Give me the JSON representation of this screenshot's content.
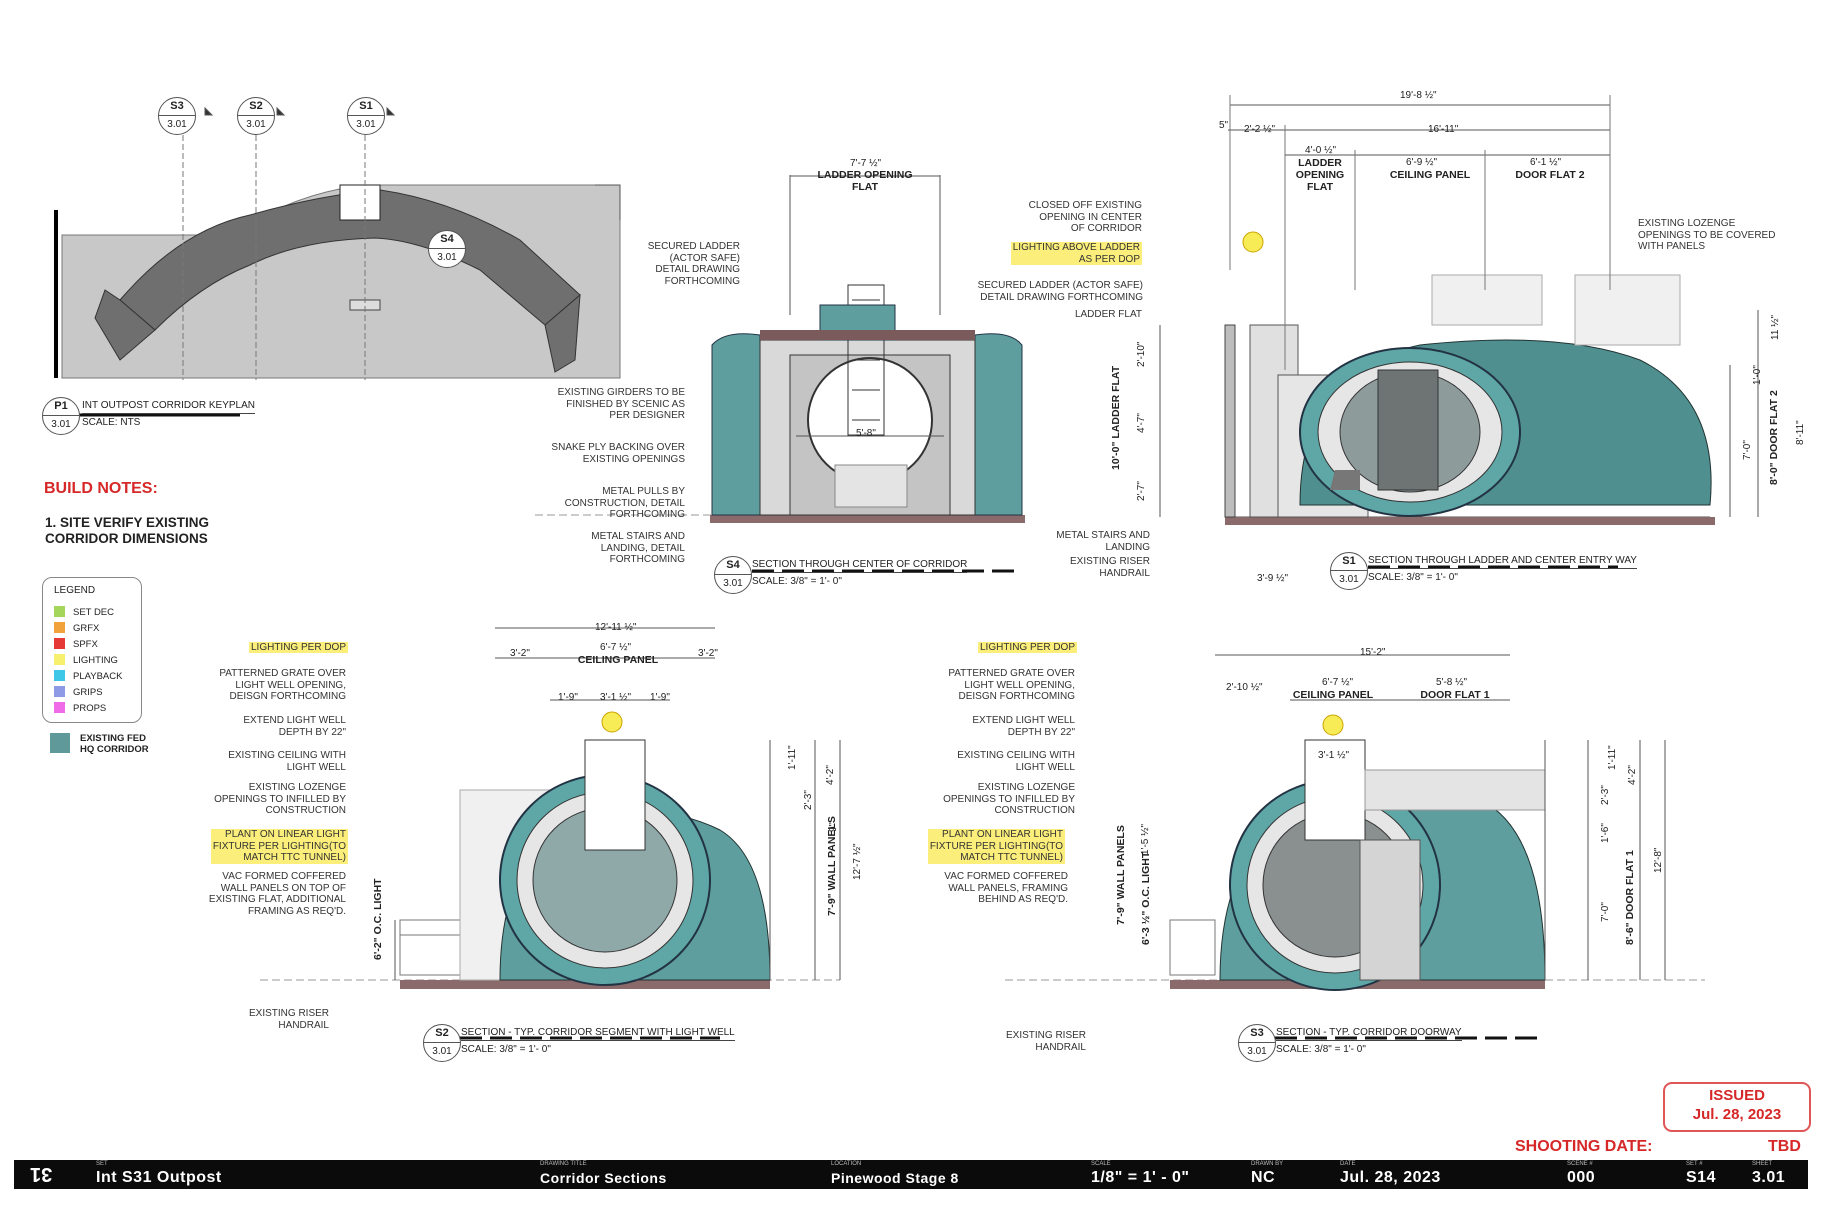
{
  "keyplan": {
    "tag_id": "P1",
    "tag_sheet": "3.01",
    "title": "INT OUTPOST CORRIDOR KEYPLAN",
    "scale": "SCALE: NTS",
    "markers": [
      {
        "id": "S3",
        "sheet": "3.01"
      },
      {
        "id": "S2",
        "sheet": "3.01"
      },
      {
        "id": "S1",
        "sheet": "3.01"
      }
    ],
    "s4_id": "S4",
    "s4_sheet": "3.01"
  },
  "notes": {
    "heading": "BUILD NOTES:",
    "item1": "1. SITE VERIFY EXISTING\nCORRIDOR DIMENSIONS"
  },
  "legend": {
    "title": "LEGEND",
    "items": [
      {
        "label": "SET DEC",
        "color": "#a3d65a"
      },
      {
        "label": "GRFX",
        "color": "#f2a23a"
      },
      {
        "label": "SPFX",
        "color": "#e53935"
      },
      {
        "label": "LIGHTING",
        "color": "#f7ef6e"
      },
      {
        "label": "PLAYBACK",
        "color": "#3fc7e8"
      },
      {
        "label": "GRIPS",
        "color": "#8e9ae6"
      },
      {
        "label": "PROPS",
        "color": "#f06be8"
      }
    ],
    "existing_label": "EXISTING FED\nHQ CORRIDOR",
    "existing_color": "#5f9999"
  },
  "s4": {
    "tag_id": "S4",
    "tag_sheet": "3.01",
    "title": "SECTION THROUGH CENTER OF CORRIDOR",
    "scale": "SCALE: 3/8\" = 1'- 0\"",
    "dim_top": "7'-7 ½\"",
    "dim_top_label": "LADDER OPENING\nFLAT",
    "dim_door": "5'-8\"",
    "notes": [
      "SECURED LADDER\n(ACTOR SAFE)\nDETAIL DRAWING\nFORTHCOMING",
      "EXISTING GIRDERS TO BE\nFINISHED BY SCENIC AS\nPER DESIGNER",
      "SNAKE PLY BACKING OVER\nEXISTING OPENINGS",
      "METAL PULLS BY\nCONSTRUCTION, DETAIL\nFORTHCOMING",
      "METAL STAIRS AND\nLANDING, DETAIL\nFORTHCOMING"
    ]
  },
  "s1": {
    "tag_id": "S1",
    "tag_sheet": "3.01",
    "title": "SECTION THROUGH LADDER AND CENTER ENTRY WAY",
    "scale": "SCALE: 3/8\" = 1'- 0\"",
    "dim_overall": "19'-8 ½\"",
    "dim_5": "5\"",
    "dim_2_2": "2'-2 ½\"",
    "dim_16_11": "16'-11\"",
    "dim_4_0": "4'-0 ½\"",
    "label_ladder": "LADDER\nOPENING\nFLAT",
    "dim_6_9": "6'-9 ½\"",
    "label_ceiling": "CEILING PANEL",
    "dim_6_1": "6'-1 ½\"",
    "label_door2": "DOOR FLAT 2",
    "vdim_2_10": "2'-10\"",
    "vdim_4_7": "4'-7\"",
    "vdim_2_7": "2'-7\"",
    "vlabel_ladder": "10'-0\" LADDER FLAT",
    "vdim_11_2": "11 ½\"",
    "vdim_1_0": "1'-0\"",
    "vdim_7_0": "7'-0\"",
    "vdim_8_0": "8'-0\" DOOR FLAT 2",
    "vdim_8_11": "8'-11\"",
    "dim_bottom": "3'-9 ½\"",
    "notes": {
      "closed": "CLOSED OFF EXISTING\nOPENING IN CENTER\nOF CORRIDOR",
      "lighting": "LIGHTING ABOVE LADDER\nAS PER DOP",
      "secured": "SECURED LADDER (ACTOR SAFE)\nDETAIL DRAWING FORTHCOMING",
      "ladder_flat": "LADDER FLAT",
      "lozenge": "EXISTING LOZENGE\nOPENINGS TO BE COVERED\nWITH PANELS",
      "stairs": "METAL STAIRS AND\nLANDING",
      "riser": "EXISTING RISER\nHANDRAIL"
    }
  },
  "s2": {
    "tag_id": "S2",
    "tag_sheet": "3.01",
    "title": "SECTION - TYP. CORRIDOR SEGMENT WITH LIGHT WELL",
    "scale": "SCALE: 3/8\" = 1'- 0\"",
    "dim_overall": "12'-11 ½\"",
    "dim_3_2a": "3'-2\"",
    "dim_6_7": "6'-7 ½\"",
    "label_ceiling": "CEILING PANEL",
    "dim_3_2b": "3'-2\"",
    "dim_1_9a": "1'-9\"",
    "dim_3_1": "3'-1 ½\"",
    "dim_1_9b": "1'-9\"",
    "vdim_1_11": "1'-11\"",
    "vdim_2_3": "2'-3\"",
    "vdim_4_2": "4'-2\"",
    "vdim_9": "9\"",
    "vdim_7_9": "7'-9\" WALL PANELS",
    "vdim_12_7": "12'-7 ½\"",
    "vdim_6_2": "6'-2\" O.C. LIGHT",
    "notes": [
      "LIGHTING PER DOP",
      "PATTERNED GRATE OVER\nLIGHT WELL OPENING,\nDEISGN FORTHCOMING",
      "EXTEND LIGHT WELL\nDEPTH BY 22\"",
      "EXISTING CEILING WITH\nLIGHT WELL",
      "EXISTING LOZENGE\nOPENINGS TO INFILLED BY\nCONSTRUCTION",
      "PLANT ON LINEAR LIGHT\nFIXTURE PER LIGHTING(TO\nMATCH TTC TUNNEL)",
      "VAC FORMED COFFERED\nWALL PANELS ON TOP OF\nEXISTING FLAT, ADDITIONAL\nFRAMING AS REQ'D.",
      "EXISTING RISER\nHANDRAIL"
    ]
  },
  "s3": {
    "tag_id": "S3",
    "tag_sheet": "3.01",
    "title": "SECTION - TYP. CORRIDOR DOORWAY",
    "scale": "SCALE: 3/8\" = 1'- 0\"",
    "dim_overall": "15'-2\"",
    "dim_2_10": "2'-10 ½\"",
    "dim_6_7": "6'-7 ½\"",
    "label_ceiling": "CEILING PANEL",
    "dim_5_8": "5'-8 ½\"",
    "label_door1": "DOOR FLAT 1",
    "dim_3_1": "3'-1 ½\"",
    "vdim_1_11": "1'-11\"",
    "vdim_2_3": "2'-3\"",
    "vdim_4_2": "4'-2\"",
    "vdim_1_6": "1'-6\"",
    "vdim_7_0": "7'-0\"",
    "vdim_8_6": "8'-6\" DOOR FLAT 1",
    "vdim_12_8": "12'-8\"",
    "vdim_7_9": "7'-9\" WALL PANELS",
    "vdim_6_3": "6'-3 ½\" O.C. LIGHT",
    "vdim_1_5": "1'-5 ½\"",
    "notes": [
      "LIGHTING PER DOP",
      "PATTERNED GRATE OVER\nLIGHT WELL OPENING,\nDEISGN FORTHCOMING",
      "EXTEND LIGHT WELL\nDEPTH BY 22\"",
      "EXISTING CEILING WITH\nLIGHT WELL",
      "EXISTING LOZENGE\nOPENINGS TO INFILLED BY\nCONSTRUCTION",
      "PLANT ON LINEAR LIGHT\nFIXTURE PER LIGHTING(TO\nMATCH TTC TUNNEL)",
      "VAC FORMED COFFERED\nWALL PANELS, FRAMING\nBEHIND AS REQ'D.",
      "EXISTING RISER\nHANDRAIL"
    ]
  },
  "stamp": {
    "line1": "ISSUED",
    "line2": "Jul. 28, 2023"
  },
  "shooting": {
    "label": "SHOOTING DATE:",
    "value": "TBD"
  },
  "titleblock": {
    "number": "31",
    "set_key": "SET",
    "set": "Int S31 Outpost",
    "drawing_key": "DRAWING TITLE",
    "drawing": "Corridor Sections",
    "location_key": "LOCATION",
    "location": "Pinewood Stage 8",
    "scale_key": "SCALE",
    "scale": "1/8\" = 1' - 0\"",
    "drawn_key": "DRAWN BY",
    "drawn": "NC",
    "date_key": "DATE",
    "date": "Jul. 28, 2023",
    "scene_key": "SCENE #",
    "scene": "000",
    "setn_key": "SET #",
    "setn": "S14",
    "sheet_key": "SHEET",
    "sheet": "3.01"
  }
}
